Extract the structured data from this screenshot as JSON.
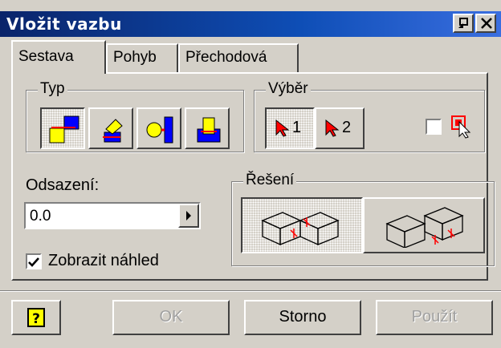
{
  "window": {
    "title": "Vložit vazbu"
  },
  "titlebar": {
    "icons": [
      "restore-icon",
      "close-icon"
    ]
  },
  "tabs": [
    {
      "label": "Sestava",
      "active": true
    },
    {
      "label": "Pohyb",
      "active": false
    },
    {
      "label": "Přechodová",
      "active": false
    }
  ],
  "type_group": {
    "label": "Typ",
    "buttons": [
      "mate-icon",
      "angle-icon",
      "tangent-icon",
      "insert-icon"
    ],
    "selected": 0
  },
  "selection_group": {
    "label": "Výběr",
    "first": {
      "number": "1",
      "pressed": true
    },
    "second": {
      "number": "2",
      "pressed": false
    },
    "checkbox_checked": false,
    "icon": "pick-part-first-icon"
  },
  "offset": {
    "label": "Odsazení:",
    "value": "0.0"
  },
  "solution_group": {
    "label": "Řešení",
    "options": [
      "mate-solution-icon",
      "flush-solution-icon"
    ],
    "selected": 0
  },
  "preview": {
    "label": "Zobrazit náhled",
    "checked": true
  },
  "buttons": {
    "help_icon": "help-icon",
    "ok": "OK",
    "ok_enabled": false,
    "cancel": "Storno",
    "apply": "Použít",
    "apply_enabled": false
  },
  "colors": {
    "titlebar": "#0a246a",
    "face": "#d4d0c8",
    "accent_red": "#ff0000",
    "accent_yellow": "#ffff00",
    "accent_blue": "#0000ff"
  }
}
